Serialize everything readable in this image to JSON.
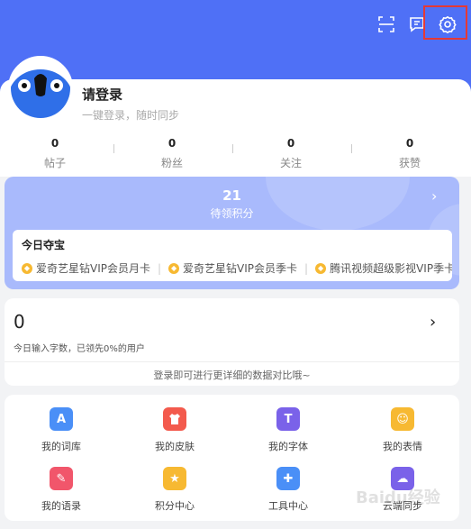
{
  "header": {
    "accent_color": "#4f70f6",
    "icons": [
      "scan-icon",
      "message-icon",
      "settings-icon"
    ]
  },
  "profile": {
    "title": "请登录",
    "subtitle": "一键登录，随时同步"
  },
  "stats": [
    {
      "value": "0",
      "label": "帖子"
    },
    {
      "value": "0",
      "label": "粉丝"
    },
    {
      "value": "0",
      "label": "关注"
    },
    {
      "value": "0",
      "label": "获赞"
    }
  ],
  "points": {
    "value": "21",
    "label": "待领积分",
    "chevron": "›"
  },
  "treasure": {
    "title": "今日夺宝",
    "items": [
      "爱奇艺星钻VIP会员月卡",
      "爱奇艺星钻VIP会员季卡",
      "腾讯视频超级影视VIP季卡"
    ],
    "separator": "|"
  },
  "input_stats": {
    "value": "0",
    "description": "今日输入字数，已领先0%的用户",
    "compare": "登录即可进行更详细的数据对比哦~",
    "chevron": "›"
  },
  "grid": [
    {
      "label": "我的词库",
      "icon": "lexicon-icon",
      "color": "#4a8ff7",
      "glyph": "A"
    },
    {
      "label": "我的皮肤",
      "icon": "skin-icon",
      "color": "#f35a4d",
      "glyph": "👕"
    },
    {
      "label": "我的字体",
      "icon": "font-icon",
      "color": "#7a62e9",
      "glyph": "T"
    },
    {
      "label": "我的表情",
      "icon": "emoji-icon",
      "color": "#f7b932",
      "glyph": "☺"
    },
    {
      "label": "我的语录",
      "icon": "quotes-icon",
      "color": "#f1566b",
      "glyph": "✎"
    },
    {
      "label": "积分中心",
      "icon": "points-center-icon",
      "color": "#f7b932",
      "glyph": "★"
    },
    {
      "label": "工具中心",
      "icon": "tools-icon",
      "color": "#4a8ff7",
      "glyph": "✚"
    },
    {
      "label": "云端同步",
      "icon": "cloud-sync-icon",
      "color": "#7a62e9",
      "glyph": "☁"
    }
  ],
  "watermark": "Baidu经验"
}
